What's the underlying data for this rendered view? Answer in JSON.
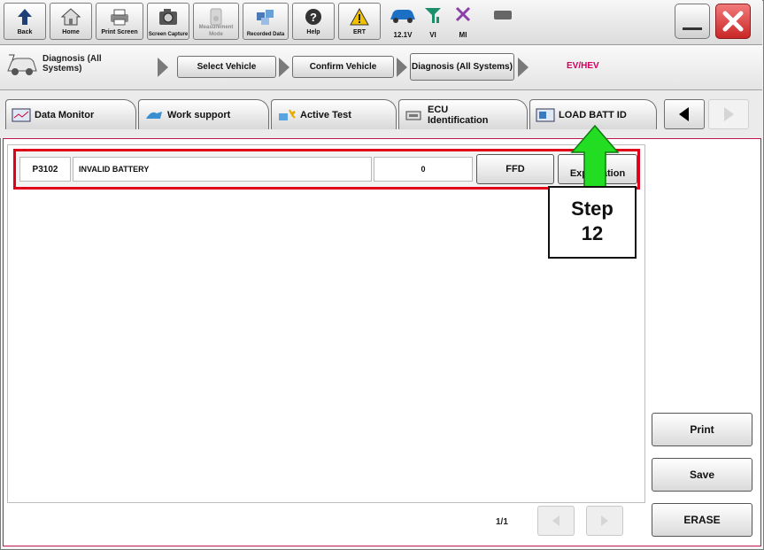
{
  "toolbar": {
    "buttons": [
      {
        "label": "Back",
        "icon": "back-arrow-icon"
      },
      {
        "label": "Home",
        "icon": "home-icon"
      },
      {
        "label": "Print Screen",
        "icon": "printer-icon"
      },
      {
        "label": "Screen Capture",
        "icon": "camera-icon"
      },
      {
        "label": "Measurement Mode",
        "icon": "meter-icon",
        "disabled": true
      },
      {
        "label": "Recorded Data",
        "icon": "recorded-data-icon"
      },
      {
        "label": "Help",
        "icon": "help-icon"
      },
      {
        "label": "ERT",
        "icon": "warning-icon"
      }
    ],
    "status": {
      "voltage": "12.1V",
      "vi": "VI",
      "mi": "MI"
    }
  },
  "breadcrumb": {
    "current": "Diagnosis (All Systems)",
    "steps": [
      "Select Vehicle",
      "Confirm Vehicle",
      "Diagnosis (All Systems)"
    ],
    "system": "EV/HEV"
  },
  "tabs": [
    {
      "label": "Data Monitor"
    },
    {
      "label": "Work support"
    },
    {
      "label": "Active Test"
    },
    {
      "label": "ECU Identification"
    },
    {
      "label": "LOAD BATT ID"
    }
  ],
  "dtc_list": {
    "rows": [
      {
        "code": "P3102",
        "description": "INVALID BATTERY",
        "count": "0",
        "ffd_label": "FFD",
        "explanation_label": "Explanation"
      }
    ]
  },
  "actions": {
    "print": "Print",
    "save": "Save",
    "erase": "ERASE"
  },
  "pager": {
    "page": "1/1"
  },
  "annotation": {
    "step_label": "Step",
    "step_number": "12",
    "arrow_color": "#22dd22"
  },
  "colors": {
    "highlight": "#e0001a",
    "ev_text": "#d0005a",
    "close": "#e23b3b"
  }
}
